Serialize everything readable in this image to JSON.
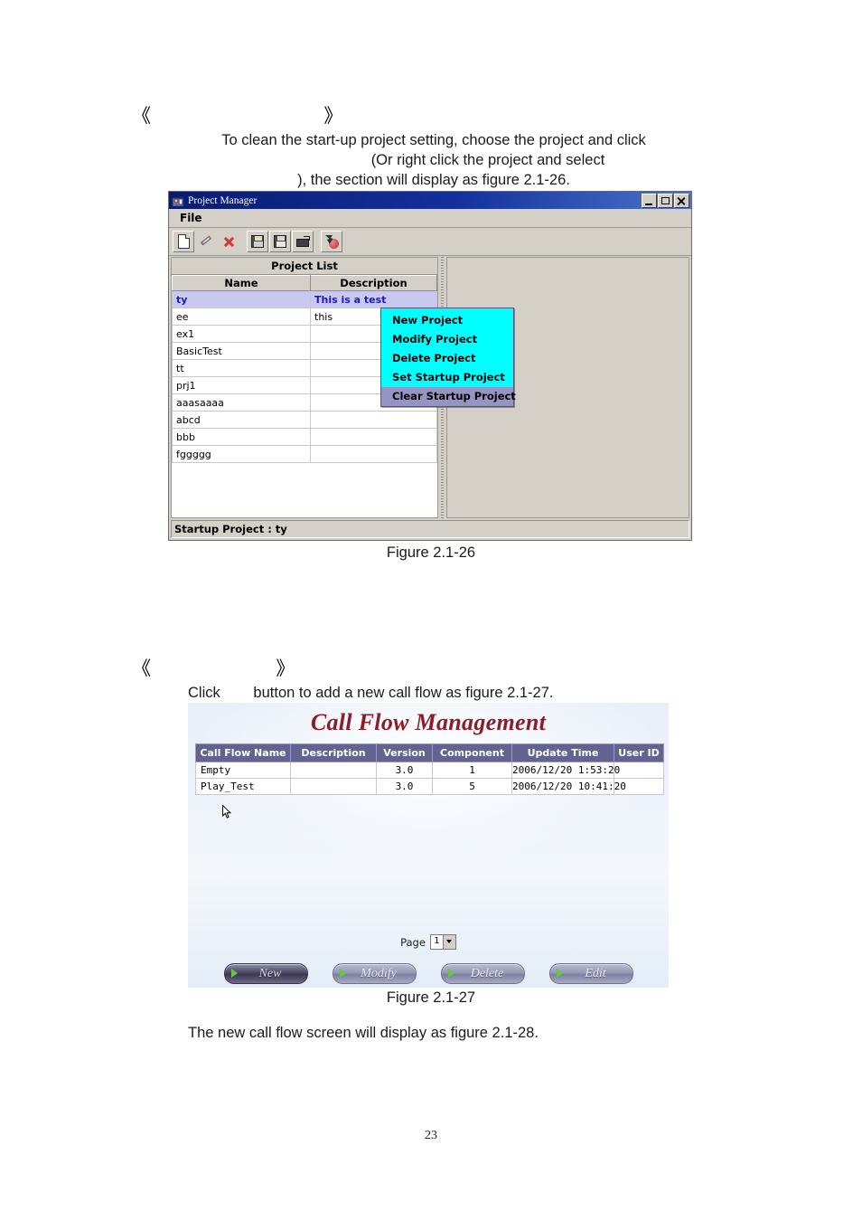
{
  "document": {
    "page_number": "23",
    "section1": {
      "heading_open": "《",
      "heading_close": "》",
      "paragraph_line1": "To clean the start-up project setting, choose the project and click",
      "paragraph_line2": "(Or right click the project and select",
      "paragraph_line3": "), the section will display as figure 2.1-26.",
      "figure_caption": "Figure 2.1-26"
    },
    "section2": {
      "heading_open": "《",
      "heading_close": "》",
      "paragraph": "Click        button to add a new call flow as figure 2.1-27.",
      "figure_caption": "Figure 2.1-27",
      "closing_paragraph": "The new call flow screen will display as figure 2.1-28."
    }
  },
  "project_manager": {
    "title": "Project Manager",
    "window_buttons": {
      "minimize": "minimize-icon",
      "maximize": "maximize-icon",
      "close": "close-icon"
    },
    "menu": {
      "file": "File"
    },
    "toolbar": [
      {
        "name": "new-project-icon",
        "glyph": "g-doc",
        "pressed": true
      },
      {
        "name": "modify-project-icon",
        "glyph": "g-pencil",
        "pressed": false
      },
      {
        "name": "delete-project-icon",
        "glyph": "g-delx",
        "pressed": false
      },
      {
        "name": "save-icon",
        "glyph": "g-save",
        "pressed": false
      },
      {
        "name": "save-as-icon",
        "glyph": "g-saveas",
        "pressed": false
      },
      {
        "name": "open-folder-icon",
        "glyph": "g-open",
        "pressed": false
      },
      {
        "name": "run-startup-icon",
        "glyph": "g-special",
        "pressed": false
      }
    ],
    "project_list": {
      "panel_title": "Project List",
      "columns": [
        "Name",
        "Description"
      ],
      "rows": [
        {
          "name": "ty",
          "description": "This is a test",
          "selected": true
        },
        {
          "name": "ee",
          "description": "this",
          "selected": false
        },
        {
          "name": "ex1",
          "description": "",
          "selected": false
        },
        {
          "name": "BasicTest",
          "description": "",
          "selected": false
        },
        {
          "name": "tt",
          "description": "",
          "selected": false
        },
        {
          "name": "prj1",
          "description": "",
          "selected": false
        },
        {
          "name": "aaasaaaa",
          "description": "",
          "selected": false
        },
        {
          "name": "abcd",
          "description": "",
          "selected": false
        },
        {
          "name": "bbb",
          "description": "",
          "selected": false
        },
        {
          "name": "fggggg",
          "description": "",
          "selected": false
        }
      ]
    },
    "context_menu": {
      "items": [
        {
          "label": "New Project",
          "highlighted": false
        },
        {
          "label": "Modify Project",
          "highlighted": false
        },
        {
          "label": "Delete Project",
          "highlighted": false
        },
        {
          "label": "Set Startup Project",
          "highlighted": false
        },
        {
          "label": "Clear Startup Project",
          "highlighted": true
        }
      ],
      "background_color": "#00ffff",
      "highlight_color": "#9595c4"
    },
    "status_bar": "Startup Project : ty"
  },
  "call_flow_management": {
    "title": "Call Flow Management",
    "title_color": "#8b1d28",
    "header_color": "#636391",
    "columns": [
      "Call Flow Name",
      "Description",
      "Version",
      "Component",
      "Update Time",
      "User ID"
    ],
    "rows": [
      {
        "call_flow_name": "Empty",
        "description": "",
        "version": "3.0",
        "component": "1",
        "update_time": "2006/12/20 1:53:20",
        "user_id": ""
      },
      {
        "call_flow_name": "Play_Test",
        "description": "",
        "version": "3.0",
        "component": "5",
        "update_time": "2006/12/20 10:41:20",
        "user_id": ""
      }
    ],
    "pager": {
      "label": "Page",
      "value": "1"
    },
    "buttons": [
      {
        "label": "New",
        "active": true
      },
      {
        "label": "Modify",
        "active": false
      },
      {
        "label": "Delete",
        "active": false
      },
      {
        "label": "Edit",
        "active": false
      }
    ]
  }
}
